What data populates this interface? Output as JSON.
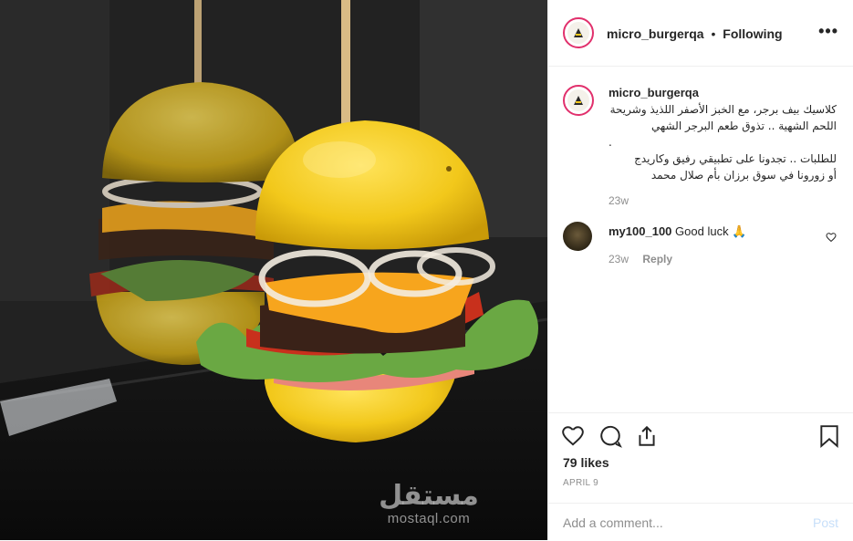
{
  "post": {
    "watermark": {
      "arabic": "مستقل",
      "latin": "mostaql.com"
    }
  },
  "header": {
    "username": "micro_burgerqa",
    "separator": "•",
    "follow_status": "Following",
    "more": "•••"
  },
  "caption": {
    "username": "micro_burgerqa",
    "text": "كلاسيك بيف برجر، مع الخبز الأصفر اللذيذ وشريحة اللحم الشهية .. تذوق طعم البرجر الشهي\n.\nللطلبات .. تجدونا على تطبيقي رفيق وكاريدج\nأو زورونا في سوق برزان بأم صلال محمد",
    "age": "23w"
  },
  "comments": [
    {
      "username": "my100_100",
      "text": "Good luck 🙏",
      "age": "23w",
      "reply_label": "Reply"
    }
  ],
  "actions": {
    "icons": [
      "heart-icon",
      "comment-icon",
      "share-icon",
      "bookmark-icon"
    ]
  },
  "likes": "79 likes",
  "date": "APRIL 9",
  "add_comment": {
    "placeholder": "Add a comment...",
    "post_label": "Post"
  },
  "colors": {
    "text": "#262626",
    "muted": "#8e8e8e",
    "story_ring": "#e1306c",
    "post_disabled": "#c7dffa",
    "bun": "#f2c81b"
  }
}
